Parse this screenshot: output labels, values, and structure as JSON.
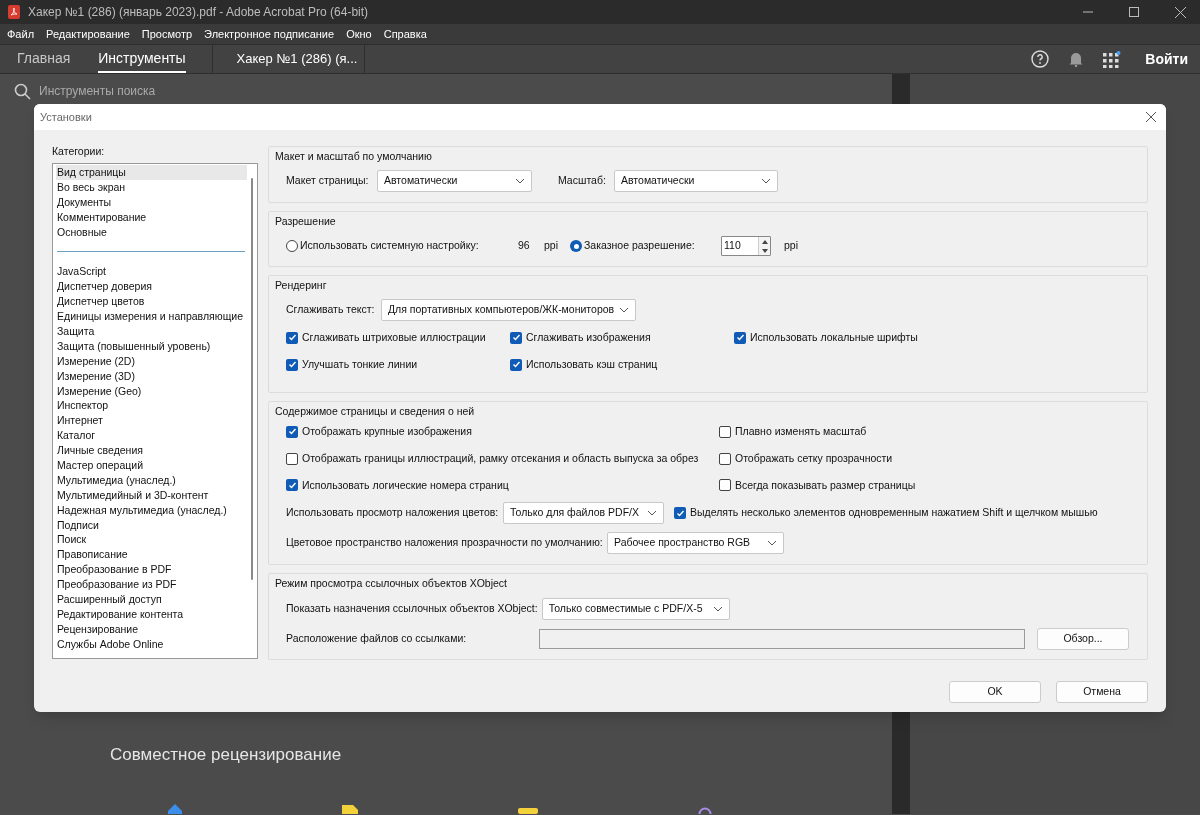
{
  "window": {
    "title": "Хакер №1 (286) (январь 2023).pdf - Adobe Acrobat Pro (64-bit)"
  },
  "menu": [
    "Файл",
    "Редактирование",
    "Просмотр",
    "Электронное подписание",
    "Окно",
    "Справка"
  ],
  "tabs": [
    {
      "label": "Главная",
      "selected": false
    },
    {
      "label": "Инструменты",
      "selected": true
    }
  ],
  "document_tab": "Хакер №1 (286) (я...",
  "sign_in": "Войти",
  "search": {
    "placeholder": "Инструменты поиска"
  },
  "section_heading": "Совместное рецензирование",
  "dialog": {
    "title": "Установки",
    "categories_label": "Категории:",
    "category_groups": [
      [
        {
          "label": "Вид страницы",
          "selected": true
        },
        {
          "label": "Во весь экран",
          "selected": false
        },
        {
          "label": "Документы",
          "selected": false
        },
        {
          "label": "Комментирование",
          "selected": false
        },
        {
          "label": "Основные",
          "selected": false
        }
      ],
      [
        {
          "label": "JavaScript",
          "selected": false
        },
        {
          "label": "Диспетчер доверия",
          "selected": false
        },
        {
          "label": "Диспетчер цветов",
          "selected": false
        },
        {
          "label": "Единицы измерения и направляющие",
          "selected": false
        },
        {
          "label": "Защита",
          "selected": false
        },
        {
          "label": "Защита (повышенный уровень)",
          "selected": false
        },
        {
          "label": "Измерение (2D)",
          "selected": false
        },
        {
          "label": "Измерение (3D)",
          "selected": false
        },
        {
          "label": "Измерение (Geo)",
          "selected": false
        },
        {
          "label": "Инспектор",
          "selected": false
        },
        {
          "label": "Интернет",
          "selected": false
        },
        {
          "label": "Каталог",
          "selected": false
        },
        {
          "label": "Личные сведения",
          "selected": false
        },
        {
          "label": "Мастер операций",
          "selected": false
        },
        {
          "label": "Мультимедиа (унаслед.)",
          "selected": false
        },
        {
          "label": "Мультимедийный и 3D-контент",
          "selected": false
        },
        {
          "label": "Надежная мультимедиа (унаслед.)",
          "selected": false
        },
        {
          "label": "Подписи",
          "selected": false
        },
        {
          "label": "Поиск",
          "selected": false
        },
        {
          "label": "Правописание",
          "selected": false
        },
        {
          "label": "Преобразование в PDF",
          "selected": false
        },
        {
          "label": "Преобразование из PDF",
          "selected": false
        },
        {
          "label": "Расширенный доступ",
          "selected": false
        },
        {
          "label": "Редактирование контента",
          "selected": false
        },
        {
          "label": "Рецензирование",
          "selected": false
        },
        {
          "label": "Службы Adobe Online",
          "selected": false
        }
      ]
    ],
    "layout": {
      "title": "Макет и масштаб по умолчанию",
      "page_layout": {
        "label": "Макет страницы:",
        "value": "Автоматически"
      },
      "zoom": {
        "label": "Масштаб:",
        "value": "Автоматически"
      }
    },
    "resolution": {
      "title": "Разрешение",
      "system": {
        "label": "Использовать системную настройку:",
        "selected": false,
        "reading": "96",
        "unit": "ppi"
      },
      "custom": {
        "label": "Заказное разрешение:",
        "selected": true,
        "value": "110",
        "unit": "ppi"
      }
    },
    "rendering": {
      "title": "Рендеринг",
      "smooth_text": {
        "label": "Сглаживать текст:",
        "value": "Для портативных компьютеров/ЖК-мониторов"
      },
      "checkboxes": [
        {
          "label": "Сглаживать штриховые иллюстрации",
          "checked": true
        },
        {
          "label": "Сглаживать изображения",
          "checked": true
        },
        {
          "label": "Использовать локальные шрифты",
          "checked": true
        },
        {
          "label": "Улучшать тонкие линии",
          "checked": true
        },
        {
          "label": "Использовать кэш страниц",
          "checked": true
        }
      ]
    },
    "page_content": {
      "title": "Содержимое страницы и сведения о ней",
      "checkboxes": [
        {
          "label": "Отображать крупные изображения",
          "checked": true
        },
        {
          "label": "Плавно изменять масштаб",
          "checked": false
        },
        {
          "label": "Отображать границы иллюстраций, рамку отсекания и область выпуска за обрез",
          "checked": false
        },
        {
          "label": "Отображать сетку прозрачности",
          "checked": false
        },
        {
          "label": "Использовать логические номера страниц",
          "checked": true
        },
        {
          "label": "Всегда показывать размер страницы",
          "checked": false
        }
      ],
      "overprint": {
        "label": "Использовать просмотр наложения цветов:",
        "value": "Только для файлов PDF/X"
      },
      "shift_select": {
        "label": "Выделять несколько элементов одновременным нажатием Shift и щелчком мышью",
        "checked": true
      },
      "blend_space": {
        "label": "Цветовое пространство наложения прозрачности по умолчанию:",
        "value": "Рабочее пространство RGB"
      }
    },
    "xobject": {
      "title": "Режим просмотра ссылочных объектов XObject",
      "show": {
        "label": "Показать назначения ссылочных объектов XObject:",
        "value": "Только совместимые с PDF/X-5"
      },
      "location": {
        "label": "Расположение файлов со ссылками:",
        "button": "Обзор..."
      }
    },
    "buttons": [
      "OK",
      "Отмена"
    ]
  }
}
